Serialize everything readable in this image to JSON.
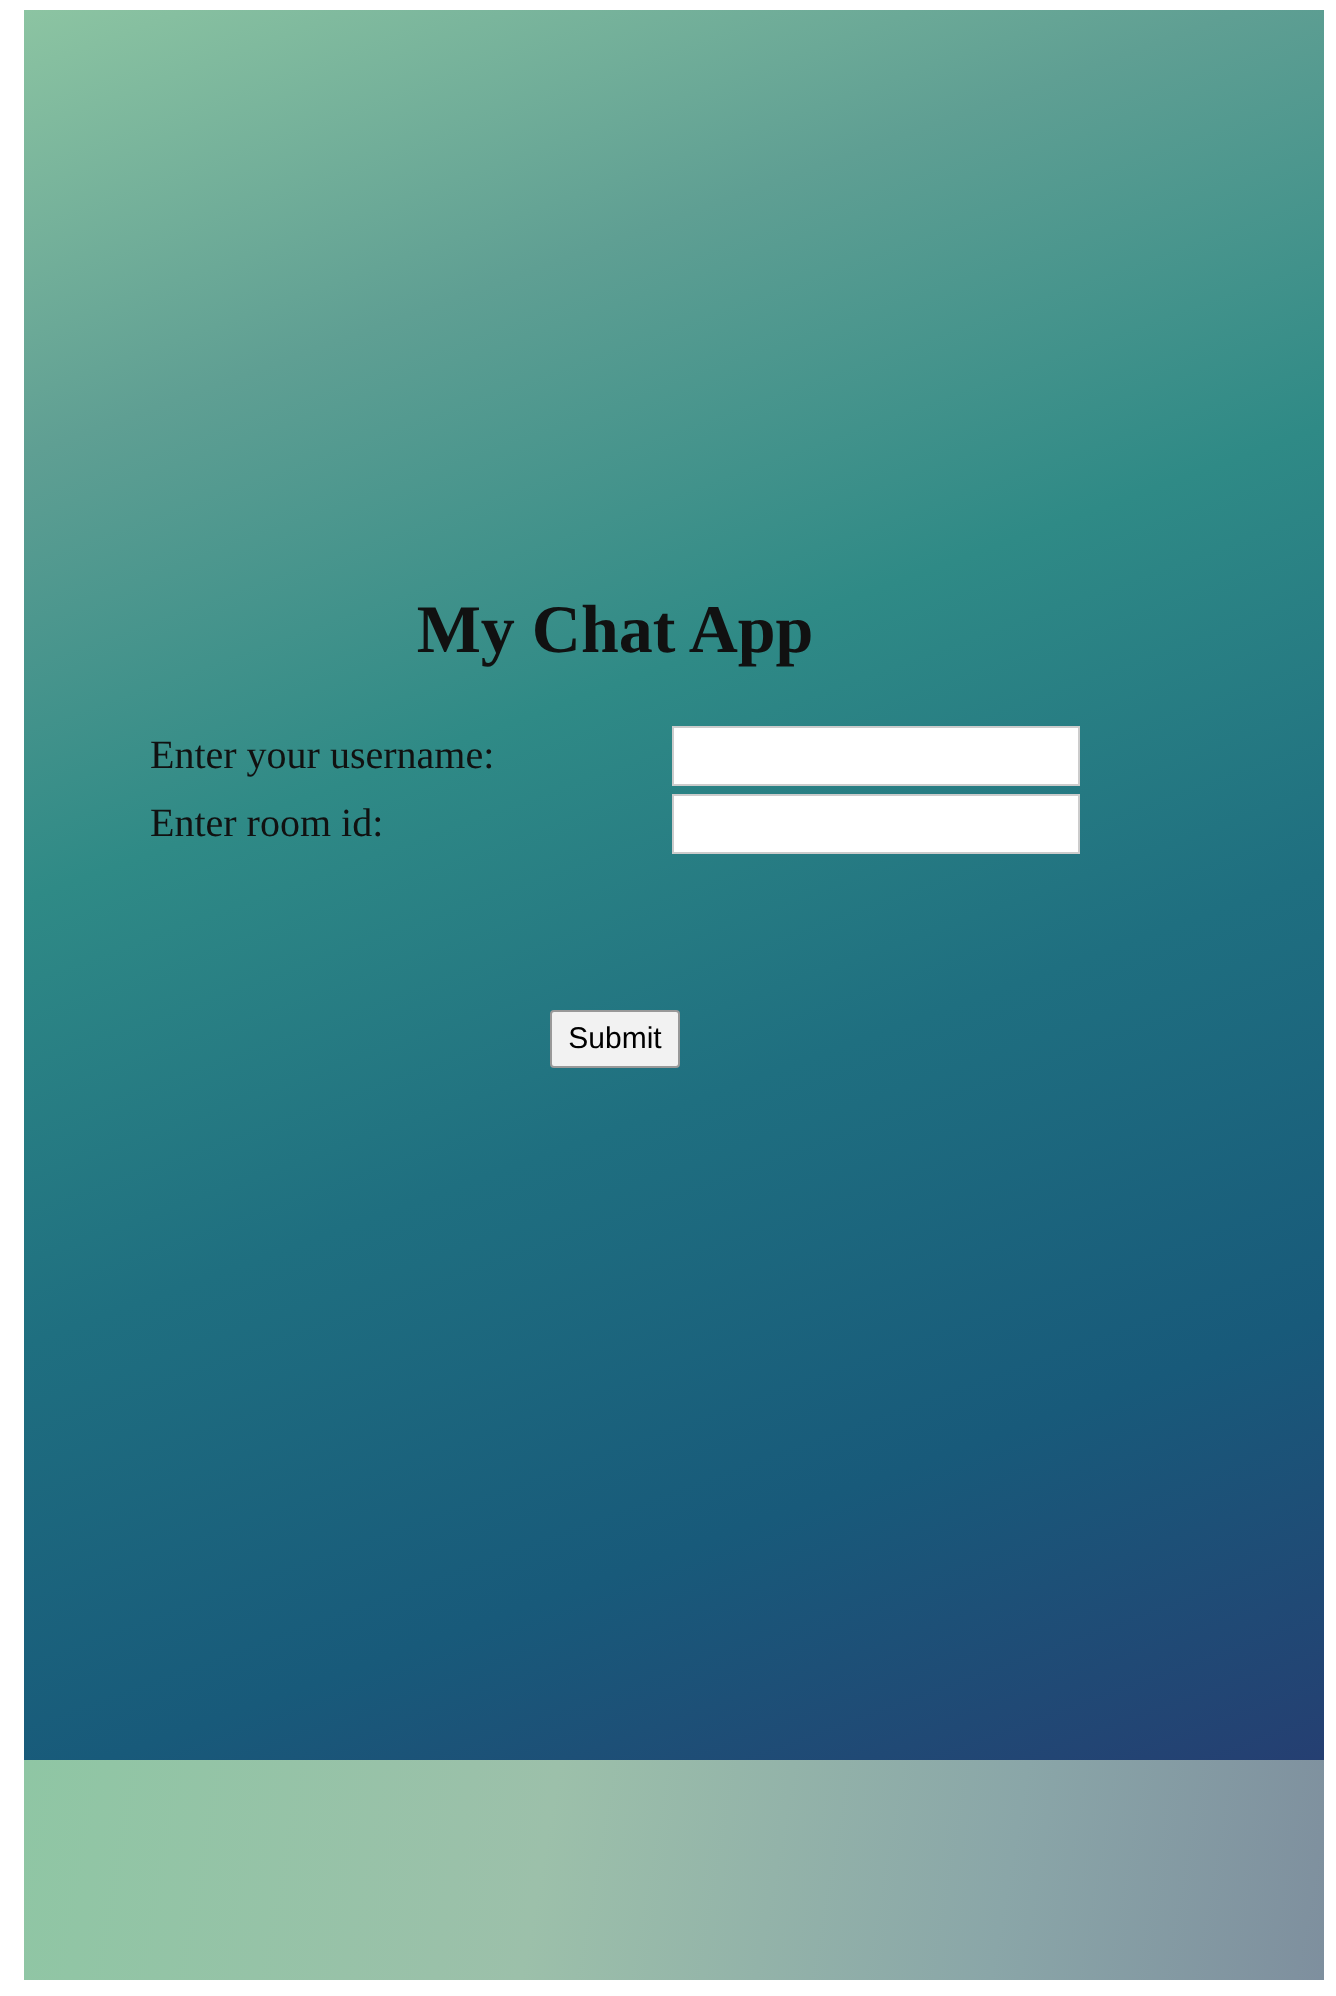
{
  "title": "My Chat App",
  "fields": [
    {
      "label": "Enter your username:"
    },
    {
      "label": "Enter room id:"
    }
  ],
  "button": "Submit"
}
